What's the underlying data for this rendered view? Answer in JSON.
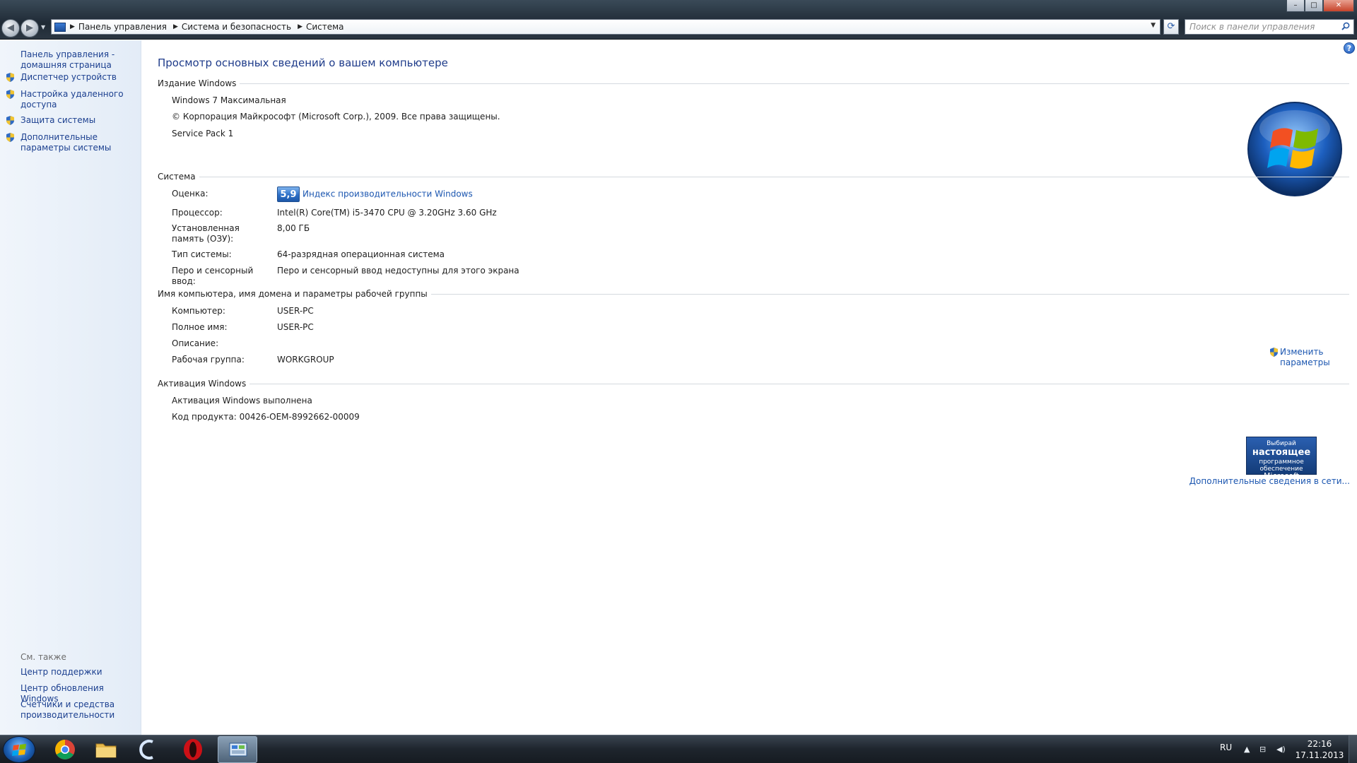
{
  "window": {
    "controls": [
      "minimize",
      "maximize",
      "close"
    ]
  },
  "address_bar": {
    "crumbs": [
      "Панель управления",
      "Система и безопасность",
      "Система"
    ]
  },
  "search": {
    "placeholder": "Поиск в панели управления"
  },
  "left_pane": {
    "home_link": "Панель управления - домашняя страница",
    "tasks": [
      {
        "label": "Диспетчер устройств",
        "icon": "shield-icon"
      },
      {
        "label": "Настройка удаленного доступа",
        "icon": "shield-icon"
      },
      {
        "label": "Защита системы",
        "icon": "shield-icon"
      },
      {
        "label": "Дополнительные параметры системы",
        "icon": "shield-icon"
      }
    ],
    "see_also_heading": "См. также",
    "see_also": [
      "Центр поддержки",
      "Центр обновления Windows",
      "Счетчики и средства производительности"
    ]
  },
  "main": {
    "title": "Просмотр основных сведений о вашем компьютере",
    "edition": {
      "heading": "Издание Windows",
      "name": "Windows 7 Максимальная",
      "copyright": "© Корпорация Майкрософт (Microsoft Corp.), 2009. Все права защищены.",
      "service_pack": "Service Pack 1"
    },
    "system": {
      "heading": "Система",
      "rating_label": "Оценка:",
      "rating_value": "5,9",
      "rating_link": "Индекс производительности Windows",
      "cpu_label": "Процессор:",
      "cpu_value": "Intel(R) Core(TM) i5-3470 CPU @ 3.20GHz   3.60 GHz",
      "ram_label": "Установленная память (ОЗУ):",
      "ram_value": "8,00 ГБ",
      "type_label": "Тип системы:",
      "type_value": "64-разрядная операционная система",
      "pen_label": "Перо и сенсорный ввод:",
      "pen_value": "Перо и сенсорный ввод недоступны для этого экрана"
    },
    "computer": {
      "heading": "Имя компьютера, имя домена и параметры рабочей группы",
      "computer_label": "Компьютер:",
      "computer_value": "USER-PC",
      "fullname_label": "Полное имя:",
      "fullname_value": "USER-PC",
      "description_label": "Описание:",
      "workgroup_label": "Рабочая группа:",
      "workgroup_value": "WORKGROUP",
      "change_link": "Изменить параметры"
    },
    "activation": {
      "heading": "Активация Windows",
      "status": "Активация Windows выполнена",
      "product_key_label": "Код продукта:",
      "product_key_value": "00426-OEM-8992662-00009",
      "genuine_line1": "Выбирай",
      "genuine_line2": "настоящее",
      "genuine_line3": "программное обеспечение",
      "genuine_line4": "Microsoft",
      "more_link": "Дополнительные сведения в сети..."
    }
  },
  "taskbar": {
    "apps": [
      "start-orb",
      "chrome",
      "explorer",
      "app-c",
      "opera",
      "control-panel"
    ],
    "active_app": "control-panel",
    "language": "RU",
    "time": "22:16",
    "date": "17.11.2013"
  },
  "colors": {
    "link": "#1b56b0",
    "title": "#1e3b8a",
    "left_pane_bg": "#e8f0f9"
  }
}
